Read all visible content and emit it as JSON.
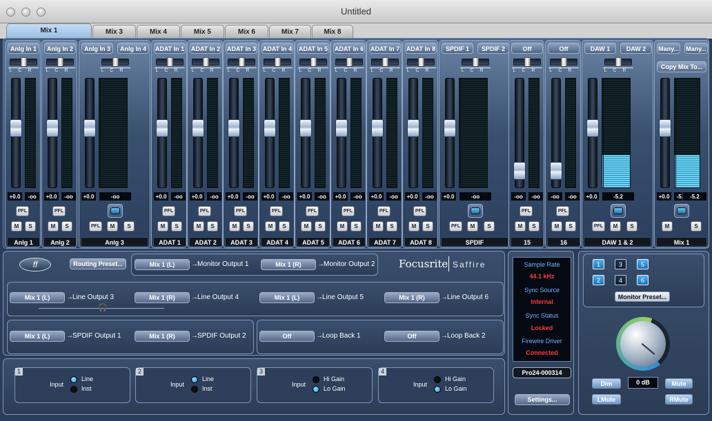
{
  "window": {
    "title": "Untitled"
  },
  "tabs": [
    "Mix 1",
    "Mix 3",
    "Mix 4",
    "Mix 5",
    "Mix 6",
    "Mix 7",
    "Mix 8"
  ],
  "active_tab": "Mix 1",
  "strips": [
    {
      "input": "Anlg In 1",
      "name": "Anlg 1",
      "vals": [
        "+0.0",
        "-oo"
      ],
      "fader": 0.56,
      "meter": 0
    },
    {
      "input": "Anlg In 2",
      "name": "Anlg 2",
      "vals": [
        "+0.0",
        "-oo"
      ],
      "fader": 0.56,
      "meter": 0
    },
    {
      "input": "Anlg In 3",
      "name": "",
      "vals": [
        "+0.0",
        "-oo"
      ],
      "fader": 0.56,
      "meter": 0
    },
    {
      "input": "Anlg In 4",
      "name": "",
      "vals": [
        "-oo"
      ],
      "fader": null,
      "meter": 0
    },
    {
      "input": "ADAT In 1",
      "name": "ADAT 1",
      "vals": [
        "+0.0",
        "-oo"
      ],
      "fader": 0.56,
      "meter": 0
    },
    {
      "input": "ADAT In 2",
      "name": "ADAT 2",
      "vals": [
        "+0.0",
        "-oo"
      ],
      "fader": 0.56,
      "meter": 0
    },
    {
      "input": "ADAT In 3",
      "name": "ADAT 3",
      "vals": [
        "+0.0",
        "-oo"
      ],
      "fader": 0.56,
      "meter": 0
    },
    {
      "input": "ADAT In 4",
      "name": "ADAT 4",
      "vals": [
        "+0.0",
        "-oo"
      ],
      "fader": 0.56,
      "meter": 0
    },
    {
      "input": "ADAT In 5",
      "name": "ADAT 5",
      "vals": [
        "+0.0",
        "-oo"
      ],
      "fader": 0.56,
      "meter": 0
    },
    {
      "input": "ADAT In 6",
      "name": "ADAT 6",
      "vals": [
        "+0.0",
        "-oo"
      ],
      "fader": 0.56,
      "meter": 0
    },
    {
      "input": "ADAT In 7",
      "name": "ADAT 7",
      "vals": [
        "+0.0",
        "-oo"
      ],
      "fader": 0.56,
      "meter": 0
    },
    {
      "input": "ADAT In 8",
      "name": "ADAT 8",
      "vals": [
        "+0.0",
        "-oo"
      ],
      "fader": 0.56,
      "meter": 0
    },
    {
      "input": "SPDIF 1",
      "name": "",
      "vals": [
        "+0.0",
        "-oo"
      ],
      "fader": 0.56,
      "meter": 0
    },
    {
      "input": "SPDIF 2",
      "name": "",
      "vals": [
        "-oo"
      ],
      "fader": null,
      "meter": 0
    },
    {
      "input": "Off",
      "name": "15",
      "vals": [
        "-oo",
        "-oo"
      ],
      "fader": 0.1,
      "meter": 0
    },
    {
      "input": "Off",
      "name": "16",
      "vals": [
        "-oo",
        "-oo"
      ],
      "fader": 0.1,
      "meter": 0
    },
    {
      "input": "DAW 1",
      "name": "",
      "vals": [
        "+0.0",
        "-5.2"
      ],
      "fader": 0.56,
      "meter": 0.3
    },
    {
      "input": "DAW 2",
      "name": "",
      "vals": [
        "-5.2"
      ],
      "fader": null,
      "meter": 0.3
    },
    {
      "input": "Many...",
      "name": "",
      "vals": [
        "+0.0",
        "-5.2"
      ],
      "fader": 0.56,
      "meter": 0.3
    },
    {
      "input": "Many...",
      "name": "",
      "vals": [
        "-5.2"
      ],
      "fader": null,
      "meter": 0.3
    }
  ],
  "stereo_names": {
    "anlg34": "Anlg 3",
    "spdif": "SPDIF",
    "daw": "DAW 1 & 2",
    "mix1": "Mix 1"
  },
  "copy_mix": "Copy Mix To...",
  "buttons": {
    "pfl": "PFL",
    "m": "M",
    "s": "S"
  },
  "routing": {
    "preset": "Routing Preset...",
    "rows": [
      {
        "src": "Mix 1 (L)",
        "dst": "Monitor Output 1"
      },
      {
        "src": "Mix 1 (R)",
        "dst": "Monitor Output 2"
      },
      {
        "src": "Mix 1 (L)",
        "dst": "Line Output 3"
      },
      {
        "src": "Mix 1 (R)",
        "dst": "Line Output 4"
      },
      {
        "src": "Mix 1 (L)",
        "dst": "Line Output 5"
      },
      {
        "src": "Mix 1 (R)",
        "dst": "Line Output 6"
      },
      {
        "src": "Mix 1 (L)",
        "dst": "SPDIF Output 1"
      },
      {
        "src": "Mix 1 (R)",
        "dst": "SPDIF Output 2"
      },
      {
        "src": "Off",
        "dst": "Loop Back 1"
      },
      {
        "src": "Off",
        "dst": "Loop Back 2"
      }
    ]
  },
  "brand": {
    "logo": "Focusrite",
    "product": "Saffire"
  },
  "inputs": [
    {
      "num": "1",
      "label": "Input",
      "opts": [
        "Line",
        "Inst"
      ],
      "selected": 0
    },
    {
      "num": "2",
      "label": "Input",
      "opts": [
        "Line",
        "Inst"
      ],
      "selected": 0
    },
    {
      "num": "3",
      "label": "Input",
      "opts": [
        "Hi Gain",
        "Lo Gain"
      ],
      "selected": 1
    },
    {
      "num": "4",
      "label": "Input",
      "opts": [
        "Hi Gain",
        "Lo Gain"
      ],
      "selected": 1
    }
  ],
  "status": {
    "sample_rate_label": "Sample Rate",
    "sample_rate": "44.1 kHz",
    "sync_source_label": "Sync Source",
    "sync_source": "Internal",
    "sync_status_label": "Sync Status",
    "sync_status": "Locked",
    "driver_label": "Firewire Driver",
    "driver": "Connected",
    "device": "Pro24-000314",
    "settings": "Settings..."
  },
  "monitor": {
    "presets": [
      "1",
      "3",
      "5",
      "2",
      "4",
      "6"
    ],
    "active": [
      "1",
      "5",
      "2",
      "6"
    ],
    "preset_btn": "Monitor Preset...",
    "level": "0 dB",
    "dim": "Dim",
    "mute": "Mute",
    "lmute": "LMute",
    "rmute": "RMute"
  },
  "colors": {
    "accent": "#4eb1f0",
    "status_red": "#ff3030",
    "window_bg": "#2a3d5a"
  }
}
